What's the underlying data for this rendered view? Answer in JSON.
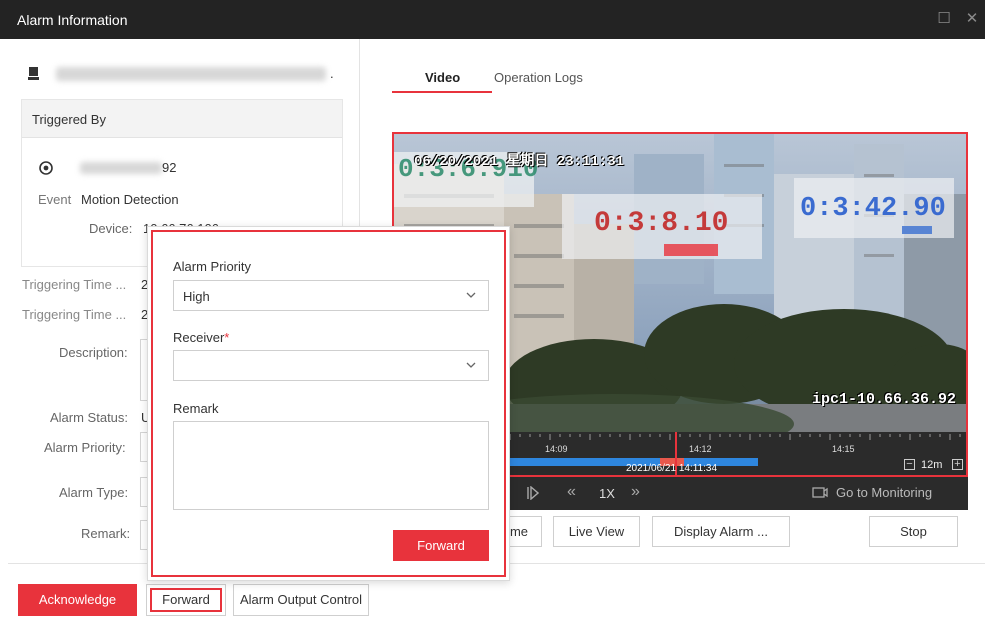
{
  "window": {
    "title": "Alarm Information"
  },
  "left": {
    "triggered_by_header": "Triggered By",
    "source_suffix": "92",
    "event_label": "Event",
    "event_value": "Motion Detection",
    "device_label": "Device:",
    "device_value": "10.66.76.106",
    "triggering_time_1_label": "Triggering Time ...",
    "triggering_time_2_label": "Triggering Time ...",
    "triggering_value_stub": "2",
    "description_label": "Description:",
    "alarm_status_label": "Alarm Status:",
    "alarm_status_stub": "U",
    "alarm_priority_label": "Alarm Priority:",
    "alarm_type_label": "Alarm Type:",
    "remark_label": "Remark:"
  },
  "tabs": [
    {
      "label": "Video"
    },
    {
      "label": "Operation Logs"
    }
  ],
  "video": {
    "osd_datetime": "06/20/2021 星期日 23:11:31",
    "timer_1": "0:3:6.910",
    "timer_2": "0:3:8.10",
    "timer_3": "0:3:42.90",
    "camera_label": "ipc1-10.66.36.92",
    "timeline": {
      "tick_1": "14:09",
      "tick_2": "14:12",
      "tick_3": "14:15",
      "current_time": "2021/06/21 14:11:34",
      "zoom": "12m"
    },
    "speed": "1X",
    "go_to_monitoring": "Go to Monitoring"
  },
  "actions": {
    "time_partial": "me",
    "live_view": "Live View",
    "display_alarm": "Display Alarm ...",
    "stop": "Stop"
  },
  "popup": {
    "alarm_priority_label": "Alarm Priority",
    "alarm_priority_value": "High",
    "receiver_label": "Receiver",
    "required_mark": "*",
    "receiver_value": "",
    "remark_label": "Remark",
    "remark_value": "",
    "forward_button": "Forward"
  },
  "bottom": {
    "acknowledge": "Acknowledge",
    "forward": "Forward",
    "alarm_output_control": "Alarm Output Control"
  },
  "colors": {
    "accent": "#e8333c",
    "titlebar": "#232323"
  }
}
